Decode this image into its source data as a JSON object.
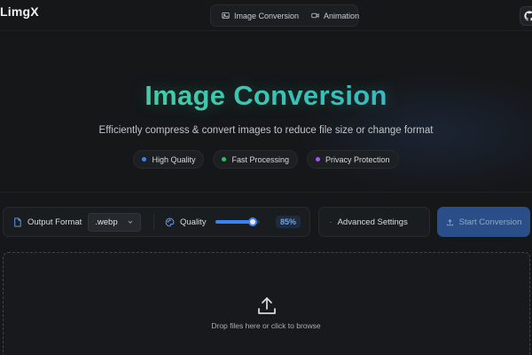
{
  "header": {
    "logo": "LimgX",
    "nav": [
      {
        "label": "Image Conversion",
        "icon": "image-icon"
      },
      {
        "label": "Animation",
        "icon": "video-icon"
      }
    ],
    "github_icon": "github-icon"
  },
  "hero": {
    "title": "Image Conversion",
    "subtitle": "Efficiently compress & convert images to reduce file size or change format",
    "badges": [
      {
        "label": "High Quality",
        "color": "#3b82f6"
      },
      {
        "label": "Fast Processing",
        "color": "#22c55e"
      },
      {
        "label": "Privacy Protection",
        "color": "#a855f7"
      }
    ]
  },
  "toolbar": {
    "output_format_label": "Output Format",
    "output_format_value": ".webp",
    "quality_label": "Quality",
    "quality_value": "85%",
    "quality_fraction": 0.85,
    "advanced_label": "Advanced Settings",
    "start_label": "Start Conversion"
  },
  "dropzone": {
    "text": "Drop files here or click to browse"
  },
  "colors": {
    "accent": "#3b82f6",
    "background": "#151719"
  }
}
